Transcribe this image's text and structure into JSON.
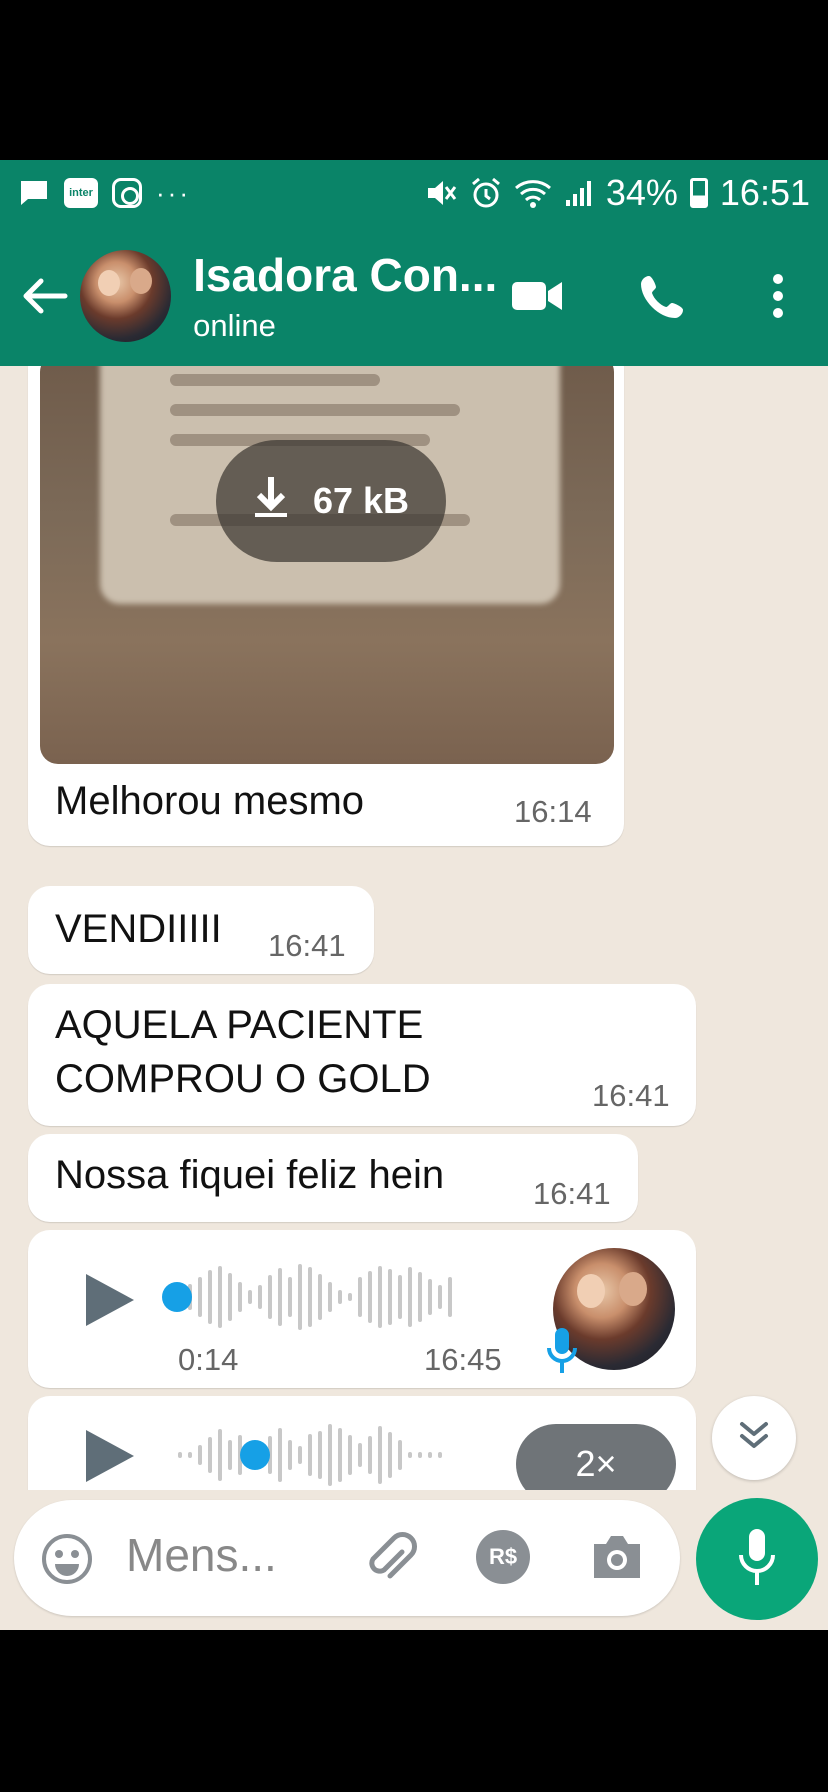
{
  "status_bar": {
    "inter_label": "inter",
    "more_dots": "···",
    "battery_percent": "34%",
    "time": "16:51"
  },
  "header": {
    "contact_name": "Isadora Con...",
    "contact_status": "online"
  },
  "messages": [
    {
      "type": "image",
      "download_size": "67 kB",
      "caption": "Melhorou mesmo",
      "time": "16:14"
    },
    {
      "type": "text",
      "text": "VENDIIIII",
      "time": "16:41"
    },
    {
      "type": "text",
      "lines": [
        "AQUELA PACIENTE",
        "COMPROU O GOLD"
      ],
      "time": "16:41"
    },
    {
      "type": "text",
      "text": "Nossa fiquei feliz hein",
      "time": "16:41"
    },
    {
      "type": "audio",
      "duration": "0:14",
      "time": "16:45",
      "progress": 0
    },
    {
      "type": "audio",
      "playback_speed": "2×",
      "progress": 0.25
    }
  ],
  "composer": {
    "placeholder": "Mens...",
    "currency_label": "R$"
  },
  "colors": {
    "header_green": "#0a8468",
    "chat_bg": "#efe7dd",
    "mic_green": "#0aa679",
    "audio_blue": "#16a0e6"
  },
  "icons": [
    "message-icon",
    "inter-app-icon",
    "instagram-icon",
    "mute-icon",
    "alarm-icon",
    "wifi-icon",
    "signal-icon",
    "battery-icon",
    "back-arrow-icon",
    "video-call-icon",
    "phone-icon",
    "more-options-icon",
    "download-icon",
    "play-icon",
    "mic-small-icon",
    "chevron-double-down-icon",
    "emoji-icon",
    "attach-icon",
    "payment-icon",
    "camera-icon",
    "mic-icon"
  ]
}
